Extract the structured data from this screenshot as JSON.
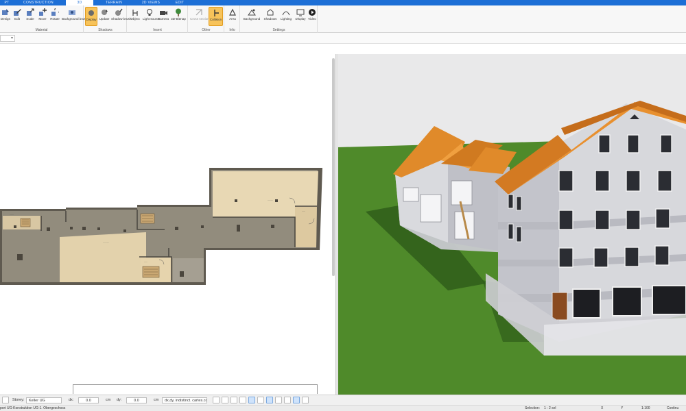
{
  "ribbon": {
    "tabs": [
      {
        "label": "PT",
        "active": false
      },
      {
        "label": "CONSTRUCTION",
        "active": false
      },
      {
        "label": "3D",
        "active": true
      },
      {
        "label": "TERRAIN",
        "active": false
      },
      {
        "label": "2D VIEWS",
        "active": false
      },
      {
        "label": "EDIT",
        "active": false
      }
    ],
    "groups": {
      "material": {
        "label": "Material",
        "buttons": [
          "Design",
          "Edit",
          "Scale",
          "Move",
          "Rotate",
          "Background brush"
        ]
      },
      "shadows": {
        "label": "Shadows",
        "buttons": [
          "Display",
          "Update",
          "Shadow brush"
        ]
      },
      "insert": {
        "label": "Insert",
        "buttons": [
          "Object",
          "Light source",
          "Camera",
          "3D-Bitmap"
        ]
      },
      "other": {
        "label": "Other",
        "buttons": [
          "Cross section 3D",
          "Collision"
        ]
      },
      "info": {
        "label": "Info",
        "buttons": [
          "Area"
        ]
      },
      "settings": {
        "label": "Settings",
        "buttons": [
          "Background",
          "Shadows",
          "Lighting",
          "Display",
          "Video"
        ]
      }
    }
  },
  "toolrow": {
    "dropdown_glyph": "▾"
  },
  "bottombar": {
    "storey_label": "Storey:",
    "storey_value": "Keller UG",
    "dx_label": "dx:",
    "dx_value": "0.0",
    "dx_unit": "cm",
    "dy_label": "dy:",
    "dy_value": "0.0",
    "dy_unit": "cm",
    "lock_glyph": "🔒",
    "mode_value": "dx,dy, indistinct. cartes.coord.",
    "toggle_icons": [
      "clock-icon",
      "measure-icon",
      "dimension-icon",
      "snap-icon",
      "line-snap-icon",
      "angle-icon",
      "ortho-icon",
      "layer-icon",
      "grid-icon",
      "object-snap-icon",
      "settings-icon",
      "more-icon"
    ]
  },
  "statusbar": {
    "left_text": "port UG-Konstruktion UG-1. Obergeschoss",
    "selection_label": "Selection:",
    "selection_value": "1 : 2 sel",
    "x_label": "X",
    "y_label": "Y",
    "scale": "1:100",
    "right_text": "Continu"
  },
  "colors": {
    "ribbon_blue": "#1d6fd6",
    "roof": "#e08a2a",
    "grass": "#4f8a2a",
    "sky": "#e9e9ea",
    "wall": "#d7d8dc",
    "floor_gray": "#928c7d",
    "floor_wood": "#e8d8b4",
    "active_button": "#f7c35a"
  },
  "views": {
    "plan": "2D floor plan",
    "view3d": "3D model view"
  }
}
